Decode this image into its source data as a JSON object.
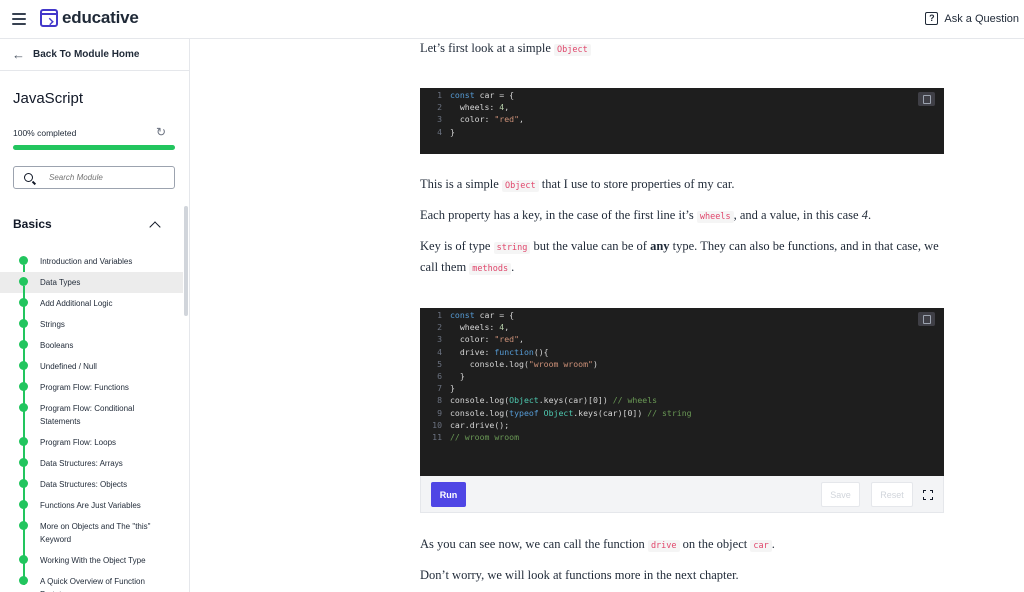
{
  "header": {
    "brand": "educative",
    "ask_label": "Ask a Question",
    "ask_icon": "?"
  },
  "sidebar": {
    "back_label": "Back To Module Home",
    "course_title": "JavaScript",
    "progress_label": "100% completed",
    "progress_fraction": 1.0,
    "search_placeholder": "Search Module",
    "section_title": "Basics",
    "lessons": [
      {
        "label": "Introduction and Variables",
        "active": false
      },
      {
        "label": "Data Types",
        "active": true
      },
      {
        "label": "Add Additional Logic",
        "active": false
      },
      {
        "label": "Strings",
        "active": false
      },
      {
        "label": "Booleans",
        "active": false
      },
      {
        "label": "Undefined / Null",
        "active": false
      },
      {
        "label": "Program Flow: Functions",
        "active": false
      },
      {
        "label": "Program Flow: Conditional Statements",
        "active": false
      },
      {
        "label": "Program Flow: Loops",
        "active": false
      },
      {
        "label": "Data Structures: Arrays",
        "active": false
      },
      {
        "label": "Data Structures: Objects",
        "active": false
      },
      {
        "label": "Functions Are Just Variables",
        "active": false
      },
      {
        "label": "More on Objects and The \"this\" Keyword",
        "active": false
      },
      {
        "label": "Working With the Object Type",
        "active": false
      },
      {
        "label": "A Quick Overview of Function Prototypes",
        "active": false
      }
    ],
    "colors": {
      "complete": "#22c55e"
    }
  },
  "content": {
    "p1_text": "Let’s first look at a simple",
    "p1_code": "Object",
    "p2_text_a": "This is a simple",
    "p2_code": "Object",
    "p2_text_b": "that I use to store properties of my car.",
    "p3_text_a": "Each property has a key, in the case of the first line it’s",
    "p3_code": "wheels",
    "p3_text_b": ", and a value, in this case",
    "p3_italic": "4",
    "p3_text_c": ".",
    "p4_text_a": "Key is of type",
    "p4_code": "string",
    "p4_text_b": "but the value can be of",
    "p4_bold": "any",
    "p4_text_c": "type. They can also be functions, and in that case, we call them",
    "p4_code2": "methods",
    "p4_text_d": ".",
    "p5_text_a": "As you can see now, we can call the function",
    "p5_code": "drive",
    "p5_text_b": "on the object",
    "p5_code2": "car",
    "p5_text_c": ".",
    "p6_text": "Don’t worry, we will look at functions more in the next chapter."
  },
  "code1": [
    [
      {
        "t": "const",
        "c": "kw"
      },
      {
        "t": " car = {",
        "c": ""
      }
    ],
    [
      {
        "t": "  wheels: ",
        "c": ""
      },
      {
        "t": "4",
        "c": "num"
      },
      {
        "t": ",",
        "c": ""
      }
    ],
    [
      {
        "t": "  color: ",
        "c": ""
      },
      {
        "t": "\"red\"",
        "c": "str"
      },
      {
        "t": ",",
        "c": ""
      }
    ],
    [
      {
        "t": "}",
        "c": ""
      }
    ]
  ],
  "code2": [
    [
      {
        "t": "const",
        "c": "kw"
      },
      {
        "t": " car = {",
        "c": ""
      }
    ],
    [
      {
        "t": "  wheels: ",
        "c": ""
      },
      {
        "t": "4",
        "c": "num"
      },
      {
        "t": ",",
        "c": ""
      }
    ],
    [
      {
        "t": "  color: ",
        "c": ""
      },
      {
        "t": "\"red\"",
        "c": "str"
      },
      {
        "t": ",",
        "c": ""
      }
    ],
    [
      {
        "t": "  drive: ",
        "c": ""
      },
      {
        "t": "function",
        "c": "kw"
      },
      {
        "t": "(){",
        "c": ""
      }
    ],
    [
      {
        "t": "    console.log(",
        "c": ""
      },
      {
        "t": "\"wroom wroom\"",
        "c": "str"
      },
      {
        "t": ")",
        "c": ""
      }
    ],
    [
      {
        "t": "  }",
        "c": ""
      }
    ],
    [
      {
        "t": "}",
        "c": ""
      }
    ],
    [
      {
        "t": "console.log(",
        "c": ""
      },
      {
        "t": "Object",
        "c": "ty"
      },
      {
        "t": ".keys(car)[0]) ",
        "c": ""
      },
      {
        "t": "// wheels",
        "c": "cm"
      }
    ],
    [
      {
        "t": "console.log(",
        "c": ""
      },
      {
        "t": "typeof",
        "c": "kw"
      },
      {
        "t": " ",
        "c": ""
      },
      {
        "t": "Object",
        "c": "ty"
      },
      {
        "t": ".keys(car)[0]) ",
        "c": ""
      },
      {
        "t": "// string",
        "c": "cm"
      }
    ],
    [
      {
        "t": "car.drive();",
        "c": ""
      }
    ],
    [
      {
        "t": "// wroom wroom",
        "c": "cm"
      }
    ]
  ],
  "runbar": {
    "run_label": "Run",
    "save_label": "Save",
    "reset_label": "Reset"
  }
}
